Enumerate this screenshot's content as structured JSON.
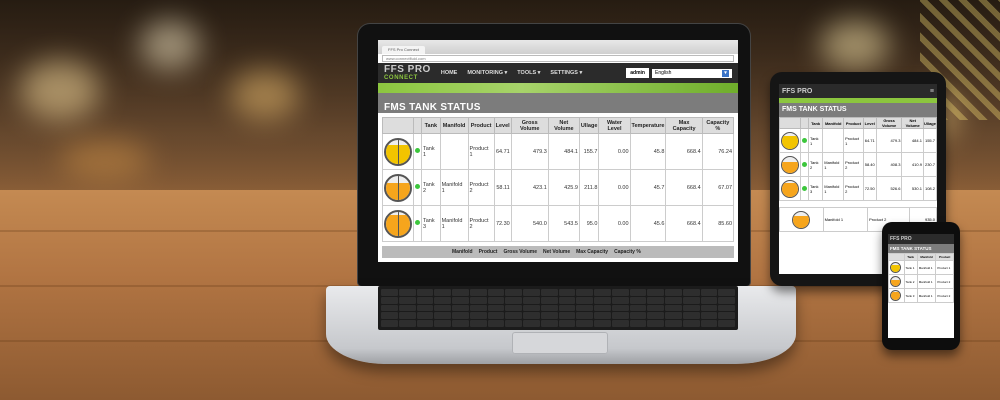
{
  "colors": {
    "brand_green": "#8cc63f",
    "nav_bg": "#2b2b2b",
    "title_bg": "#7c7c7c",
    "status_green": "#3cc63c",
    "tank_yellow": "#f2c400",
    "tank_orange": "#f6a51c"
  },
  "browser": {
    "tab_title": "FFS Pro Connect",
    "url": "www.connectfluid.com"
  },
  "brand": {
    "line1": "FFS PRO",
    "line2": "CONNECT"
  },
  "nav": {
    "items": [
      "HOME",
      "MONITORING ▾",
      "TOOLS ▾",
      "SETTINGS ▾"
    ],
    "user": "admin",
    "language": "English"
  },
  "page": {
    "title": "FMS TANK STATUS"
  },
  "table": {
    "headers": [
      "",
      "",
      "Tank",
      "Manifold",
      "Product",
      "Level",
      "Gross Volume",
      "Net Volume",
      "Ullage",
      "Water Level",
      "Temperature",
      "Max Capacity",
      "Capacity %"
    ],
    "rows": [
      {
        "tank": "Tank 1",
        "manifold": "",
        "product": "Product 1",
        "level": "64.71",
        "gross": "479.3",
        "net": "484.1",
        "ullage": "155.7",
        "water": "0.00",
        "temp": "45.8",
        "max": "668.4",
        "capacity": "76.24",
        "fill_pct": 76,
        "color": "yellow"
      },
      {
        "tank": "Tank 2",
        "manifold": "Manifold 1",
        "product": "Product 2",
        "level": "58.11",
        "gross": "423.1",
        "net": "425.9",
        "ullage": "211.8",
        "water": "0.00",
        "temp": "45.7",
        "max": "668.4",
        "capacity": "67.07",
        "fill_pct": 67,
        "color": "orange"
      },
      {
        "tank": "Tank 3",
        "manifold": "Manifold 1",
        "product": "Product 2",
        "level": "72.30",
        "gross": "540.0",
        "net": "543.5",
        "ullage": "95.0",
        "water": "0.00",
        "temp": "45.6",
        "max": "668.4",
        "capacity": "85.60",
        "fill_pct": 86,
        "color": "orange"
      }
    ],
    "manifold_headers": [
      "Manifold",
      "Product",
      "Gross Volume",
      "Net Volume",
      "Max Capacity",
      "Capacity %"
    ]
  },
  "tablet": {
    "title": "FMS TANK STATUS",
    "rows": [
      {
        "tank": "Tank 1",
        "manifold": "",
        "product": "Product 1",
        "level": "64.71",
        "gross": "479.3",
        "net": "484.1",
        "ullage": "155.7"
      },
      {
        "tank": "Tank 2",
        "manifold": "Manifold 1",
        "product": "Product 2",
        "level": "58.40",
        "gross": "408.3",
        "net": "410.9",
        "ullage": "230.7"
      },
      {
        "tank": "Tank 3",
        "manifold": "Manifold 1",
        "product": "Product 2",
        "level": "72.50",
        "gross": "526.6",
        "net": "530.1",
        "ullage": "108.2"
      }
    ],
    "manifold_row": {
      "manifold": "Manifold 1",
      "product": "Product 2",
      "gross": "935.0"
    }
  },
  "phone": {
    "title": "FMS TANK STATUS",
    "rows": [
      {
        "tank": "Tank 1",
        "manifold": "Manifold 1",
        "product": "Product 1"
      },
      {
        "tank": "Tank 2",
        "manifold": "Manifold 1",
        "product": "Product 2"
      },
      {
        "tank": "Tank 3",
        "manifold": "Manifold 1",
        "product": "Product 2"
      }
    ]
  }
}
